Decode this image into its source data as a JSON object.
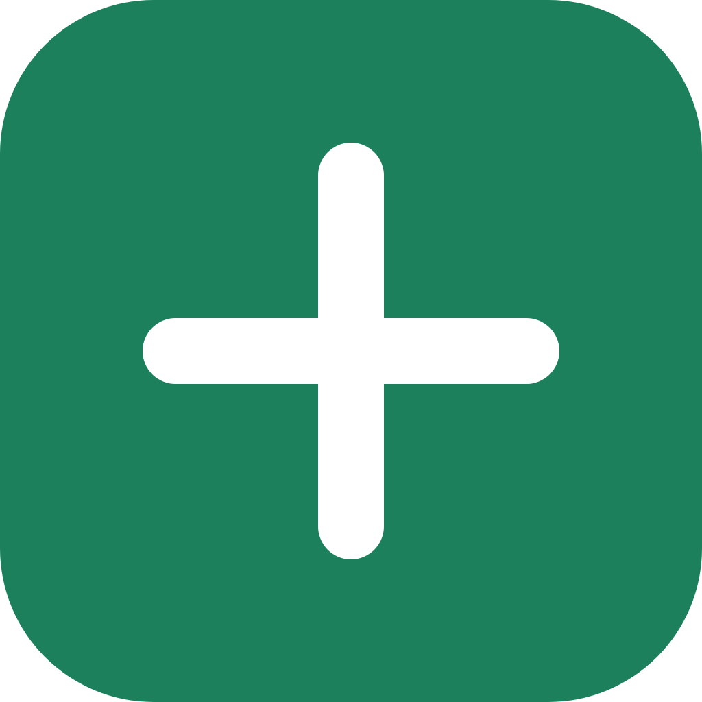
{
  "button": {
    "icon": "plus-icon",
    "background_color": "#1c805d",
    "icon_color": "#ffffff"
  }
}
